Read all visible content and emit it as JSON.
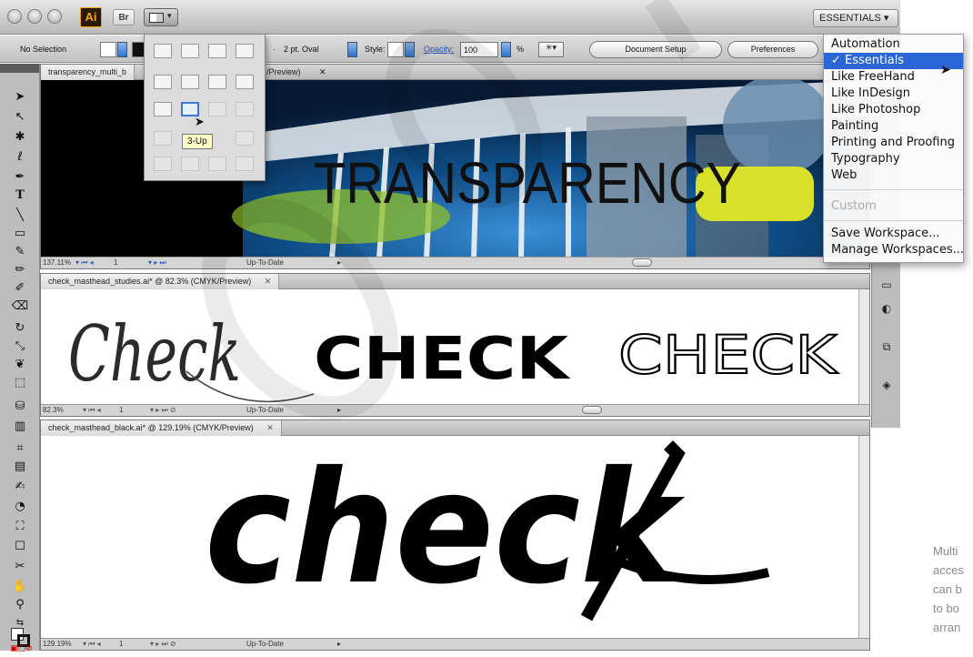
{
  "app": {
    "logo_text": "Ai",
    "bridge_label": "Br",
    "workspace_button": "ESSENTIALS ▾"
  },
  "control_panel": {
    "selection_label": "No Selection",
    "brush_value": "2 pt. Oval",
    "style_label": "Style:",
    "opacity_label": "Opacity:",
    "opacity_value": "100",
    "percent_sign": "%",
    "document_setup": "Document Setup",
    "preferences": "Preferences"
  },
  "arrange_popup": {
    "tooltip": "3-Up"
  },
  "documents": [
    {
      "tab": "transparency_multi_b",
      "tab_suffix": "/Preview)",
      "zoom": "137.11%",
      "page": "1",
      "status": "Up-To-Date",
      "art_text": "TRANSPARENCY"
    },
    {
      "tab": "check_masthead_studies.ai* @ 82.3% (CMYK/Preview)",
      "zoom": "82.3%",
      "page": "1",
      "status": "Up-To-Date",
      "art_text_1": "Check",
      "art_text_2": "CHECK",
      "art_text_3": "CHECK"
    },
    {
      "tab": "check_masthead_black.ai* @ 129.19% (CMYK/Preview)",
      "zoom": "129.19%",
      "page": "1",
      "status": "Up-To-Date",
      "art_text": "check"
    }
  ],
  "workspace_menu": {
    "items": [
      "Automation",
      "✓ Essentials",
      "Like FreeHand",
      "Like InDesign",
      "Like Photoshop",
      "Painting",
      "Printing and Proofing",
      "Typography",
      "Web"
    ],
    "disabled_item": "Custom",
    "actions": [
      "Save Workspace...",
      "Manage Workspaces..."
    ]
  },
  "caption": {
    "lines": [
      "Multi",
      "acces",
      "can b",
      "to bo",
      "arran"
    ]
  },
  "colors": {
    "menu_highlight": "#2a66d6",
    "ai_logo": "#f7a800",
    "accent_yellow": "#d8e02a"
  }
}
